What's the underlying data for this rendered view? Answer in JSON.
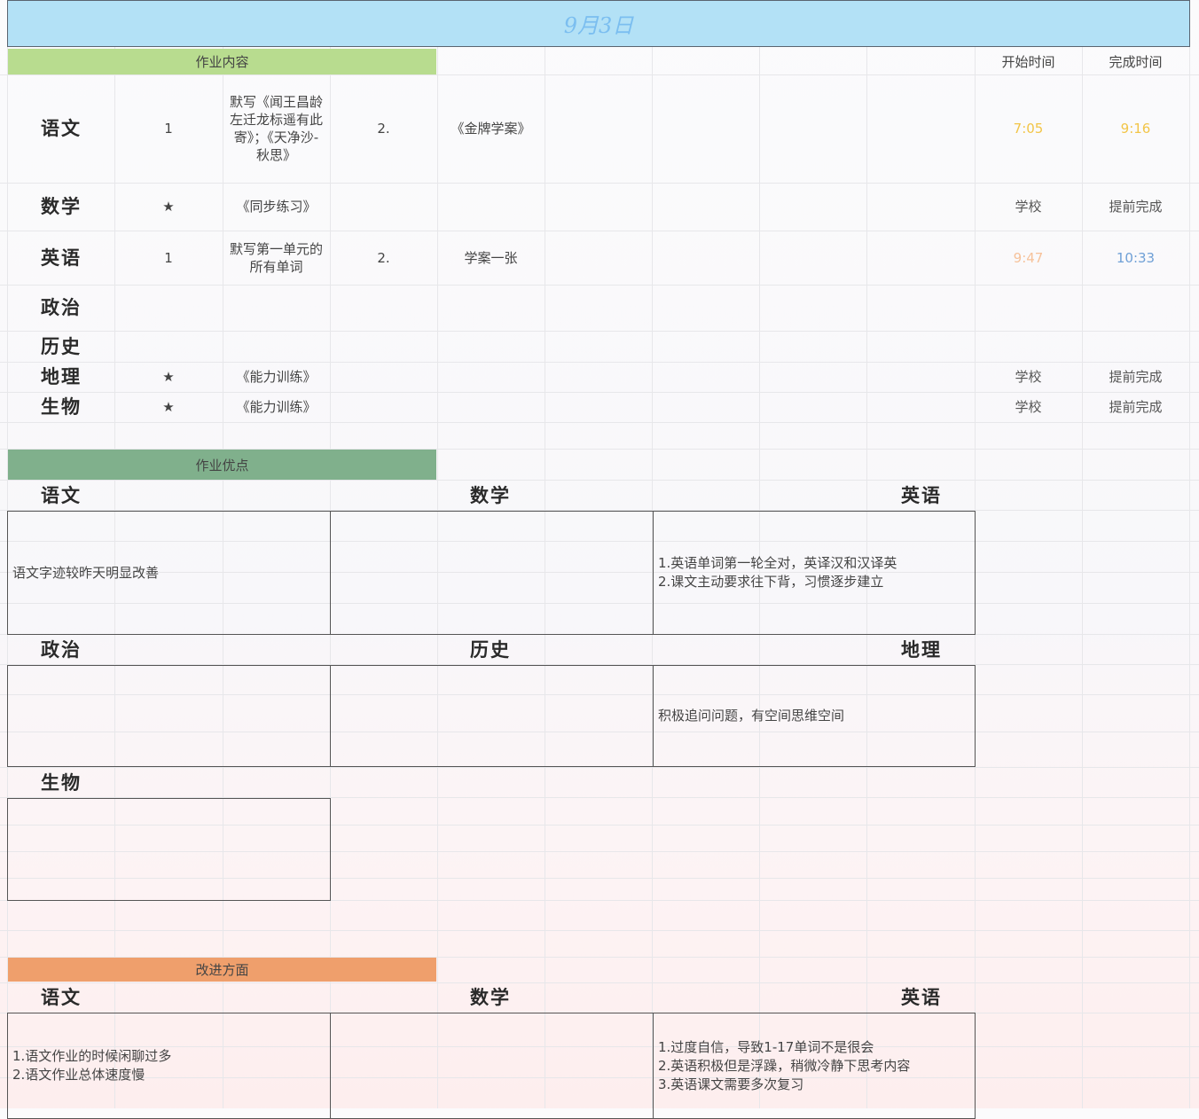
{
  "title": "9月3日",
  "homework": {
    "section_label": "作业内容",
    "start_header": "开始时间",
    "end_header": "完成时间",
    "rows": [
      {
        "subject": "语文",
        "mark": "1",
        "task1": "默写《闻王昌龄左迁龙标遥有此寄》；《天净沙-秋思》",
        "mark2": "2.",
        "task2": "《金牌学案》",
        "start": "7:05",
        "end": "9:16"
      },
      {
        "subject": "数学",
        "mark": "★",
        "task1": "《同步练习》",
        "mark2": "",
        "task2": "",
        "start": "学校",
        "end": "提前完成"
      },
      {
        "subject": "英语",
        "mark": "1",
        "task1": "默写第一单元的所有单词",
        "mark2": "2.",
        "task2": "学案一张",
        "start": "9:47",
        "end": "10:33"
      },
      {
        "subject": "政治",
        "mark": "",
        "task1": "",
        "mark2": "",
        "task2": "",
        "start": "",
        "end": ""
      },
      {
        "subject": "历史",
        "mark": "",
        "task1": "",
        "mark2": "",
        "task2": "",
        "start": "",
        "end": ""
      },
      {
        "subject": "地理",
        "mark": "★",
        "task1": "《能力训练》",
        "mark2": "",
        "task2": "",
        "start": "学校",
        "end": "提前完成"
      },
      {
        "subject": "生物",
        "mark": "★",
        "task1": "《能力训练》",
        "mark2": "",
        "task2": "",
        "start": "学校",
        "end": "提前完成"
      }
    ]
  },
  "strengths": {
    "section_label": "作业优点",
    "items": [
      {
        "subject": "语文",
        "text": "语文字迹较昨天明显改善"
      },
      {
        "subject": "数学",
        "text": ""
      },
      {
        "subject": "英语",
        "text": "1.英语单词第一轮全对，英译汉和汉译英\n2.课文主动要求往下背，习惯逐步建立"
      },
      {
        "subject": "政治",
        "text": ""
      },
      {
        "subject": "历史",
        "text": ""
      },
      {
        "subject": "地理",
        "text": "积极追问问题，有空间思维空间"
      },
      {
        "subject": "生物",
        "text": ""
      }
    ]
  },
  "improvements": {
    "section_label": "改进方面",
    "items": [
      {
        "subject": "语文",
        "text": "1.语文作业的时候闲聊过多\n2.语文作业总体速度慢"
      },
      {
        "subject": "数学",
        "text": ""
      },
      {
        "subject": "英语",
        "text": "1.过度自信，导致1-17单词不是很会\n2.英语积极但是浮躁，稍微冷静下思考内容\n3.英语课文需要多次复习"
      }
    ]
  },
  "colors": {
    "title_bg": "#b3e1f6",
    "title_text": "#7bbef0",
    "homework_header": "#b8dc8f",
    "strengths_header": "#80b08c",
    "improvements_header": "#ef9f6c",
    "time_yellow": "#f2c548",
    "time_peach": "#f6c29a",
    "time_blue": "#6fa0d6"
  }
}
